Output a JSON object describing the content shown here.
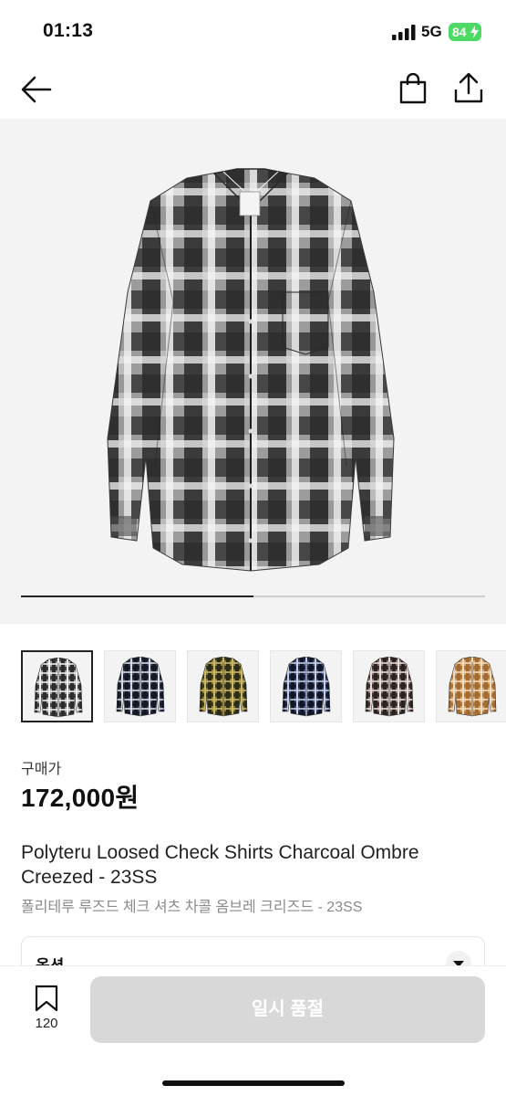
{
  "status_bar": {
    "time": "01:13",
    "network": "5G",
    "battery": "84"
  },
  "nav": {
    "back_icon": "arrow-left-icon",
    "bag_icon": "shopping-bag-icon",
    "share_icon": "share-icon"
  },
  "gallery": {
    "image_position": 0.5,
    "thumbnails": [
      {
        "name": "charcoal-ombre",
        "colors": [
          "#2b2b2b",
          "#9a9a9a",
          "#efefef"
        ],
        "selected": true
      },
      {
        "name": "navy-check",
        "colors": [
          "#141826",
          "#3b4257",
          "#d9dbe3"
        ],
        "selected": false
      },
      {
        "name": "olive-check",
        "colors": [
          "#2a2a18",
          "#8a7a2c",
          "#c9b76a"
        ],
        "selected": false
      },
      {
        "name": "navy-blue-check",
        "colors": [
          "#111525",
          "#3a4a77",
          "#c7cfe0"
        ],
        "selected": false
      },
      {
        "name": "brown-check",
        "colors": [
          "#2a2220",
          "#8a7670",
          "#e6dcd9"
        ],
        "selected": false
      },
      {
        "name": "tan-check",
        "colors": [
          "#a36b32",
          "#d9a66b",
          "#f0dcc0"
        ],
        "selected": false
      }
    ]
  },
  "product": {
    "price_label": "구매가",
    "price": "172,000원",
    "title_en": "Polyteru Loosed Check Shirts Charcoal Ombre Creezed - 23SS",
    "title_ko": "폴리테루 루즈드 체크 셔츠 차콜 옴브레 크리즈드 - 23SS"
  },
  "option": {
    "label": "옵션",
    "chevron_icon": "chevron-down-icon"
  },
  "bottom": {
    "bookmark_icon": "bookmark-icon",
    "bookmark_count": "120",
    "soldout_label": "일시 품절"
  }
}
